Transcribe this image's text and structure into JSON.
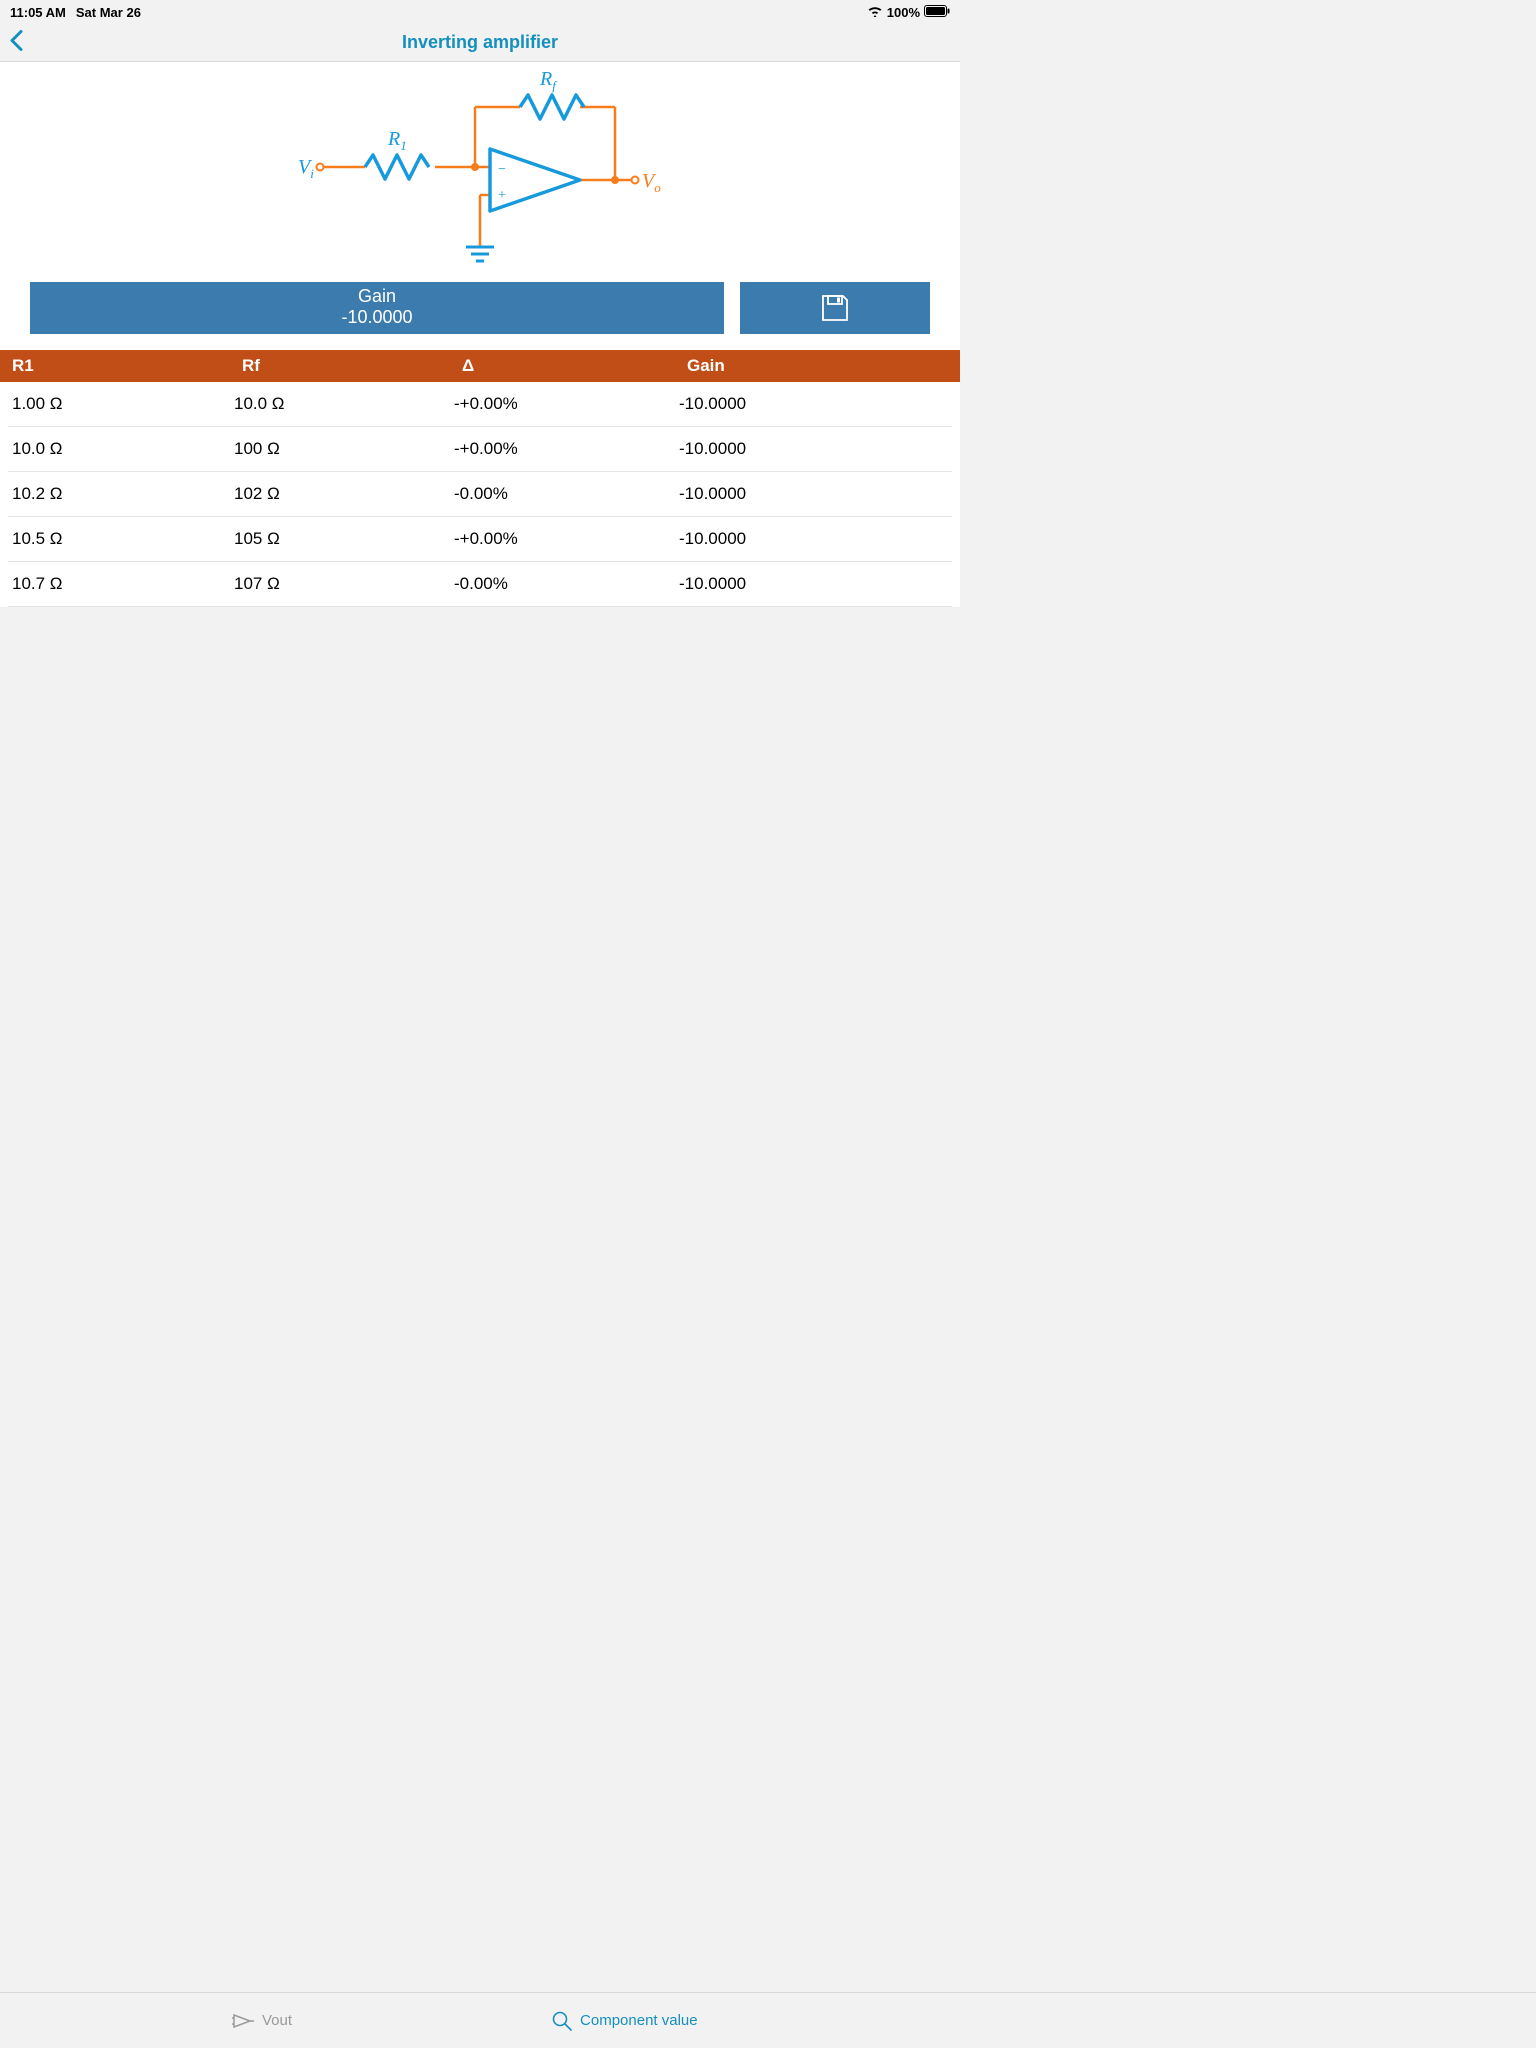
{
  "status": {
    "time": "11:05 AM",
    "date": "Sat Mar 26",
    "battery": "100%"
  },
  "nav": {
    "title": "Inverting amplifier"
  },
  "circuit": {
    "Vi": "V",
    "Vi_sub": "i",
    "R1": "R",
    "R1_sub": "1",
    "Rf": "R",
    "Rf_sub": "f",
    "Vo": "V",
    "Vo_sub": "o"
  },
  "gain_button": {
    "label": "Gain",
    "value": "-10.0000"
  },
  "table": {
    "headers": {
      "r1": "R1",
      "rf": "Rf",
      "delta": "Δ",
      "gain": "Gain"
    },
    "rows": [
      {
        "r1": "1.00 Ω",
        "rf": "10.0 Ω",
        "delta": "-+0.00%",
        "gain": "-10.0000"
      },
      {
        "r1": "10.0 Ω",
        "rf": "100 Ω",
        "delta": "-+0.00%",
        "gain": "-10.0000"
      },
      {
        "r1": "10.2 Ω",
        "rf": "102 Ω",
        "delta": "-0.00%",
        "gain": "-10.0000"
      },
      {
        "r1": "10.5 Ω",
        "rf": "105 Ω",
        "delta": "-+0.00%",
        "gain": "-10.0000"
      },
      {
        "r1": "10.7 Ω",
        "rf": "107 Ω",
        "delta": "-0.00%",
        "gain": "-10.0000"
      }
    ]
  },
  "toolbar": {
    "vout": "Vout",
    "component": "Component value"
  }
}
